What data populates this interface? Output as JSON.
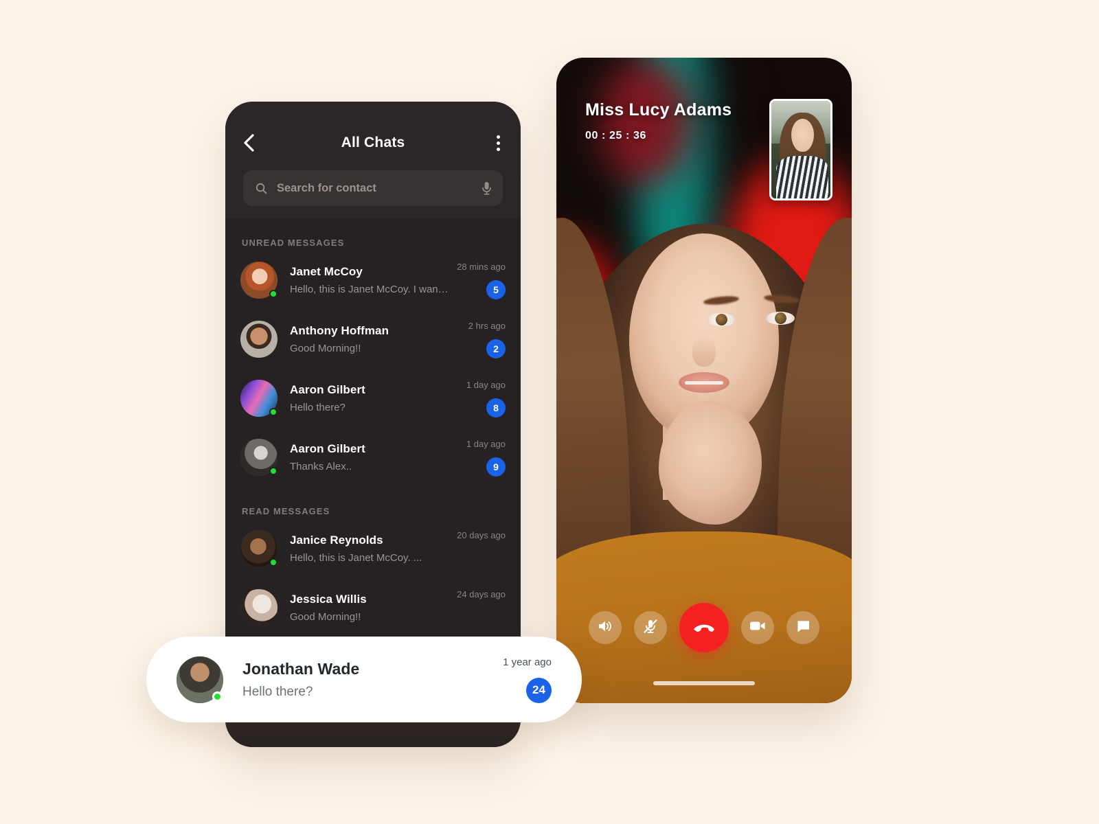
{
  "theme": {
    "page_bg": "#FBF3E8",
    "panel_dark": "#2B2627",
    "list_dark": "#262223",
    "accent_blue": "#1A63E8",
    "end_call_red": "#F42121",
    "online_green": "#22E033"
  },
  "chat_screen": {
    "header": {
      "back_icon": "chevron-left-icon",
      "title": "All Chats",
      "menu_icon": "kebab-menu-icon"
    },
    "search": {
      "icon": "search-icon",
      "placeholder": "Search for contact",
      "value": "",
      "mic_icon": "microphone-icon"
    },
    "sections": [
      {
        "label": "UNREAD MESSAGES",
        "rows": [
          {
            "name": "Janet McCoy",
            "message": "Hello, this is Janet McCoy. I want ...",
            "time": "28 mins ago",
            "badge": "5",
            "online": true,
            "avatar": "janet-mccoy"
          },
          {
            "name": "Anthony Hoffman",
            "message": "Good Morning!!",
            "time": "2 hrs ago",
            "badge": "2",
            "online": false,
            "avatar": "anthony-hoffman"
          },
          {
            "name": "Aaron Gilbert",
            "message": "Hello there?",
            "time": "1 day ago",
            "badge": "8",
            "online": true,
            "avatar": "aaron-gilbert-neon"
          },
          {
            "name": "Aaron Gilbert",
            "message": "Thanks Alex..",
            "time": "1 day ago",
            "badge": "9",
            "online": true,
            "avatar": "aaron-gilbert-bw"
          }
        ]
      },
      {
        "label": "READ MESSAGES",
        "rows": [
          {
            "name": "Janice Reynolds",
            "message": "Hello, this is Janet McCoy. ...",
            "time": "20 days ago",
            "badge": "",
            "online": true,
            "avatar": "janice-reynolds"
          },
          {
            "name": "Jessica Willis",
            "message": "Good Morning!!",
            "time": "24 days ago",
            "badge": "",
            "online": false,
            "avatar": "jessica-willis"
          }
        ]
      }
    ],
    "floating_card": {
      "name": "Jonathan Wade",
      "message": "Hello there?",
      "time": "1 year ago",
      "badge": "24",
      "online": true,
      "avatar": "jonathan-wade"
    }
  },
  "call_screen": {
    "caller_name": "Miss Lucy Adams",
    "timer": "00 : 25 : 36",
    "self_view": "self-view-pip",
    "controls": [
      {
        "name": "speaker-button",
        "icon": "speaker-icon",
        "state": "on"
      },
      {
        "name": "mute-button",
        "icon": "microphone-muted-icon",
        "state": "muted"
      },
      {
        "name": "end-call-button",
        "icon": "phone-hangup-icon",
        "state": "active"
      },
      {
        "name": "video-button",
        "icon": "video-camera-icon",
        "state": "on"
      },
      {
        "name": "chat-button",
        "icon": "chat-bubble-icon",
        "state": "on"
      }
    ]
  }
}
